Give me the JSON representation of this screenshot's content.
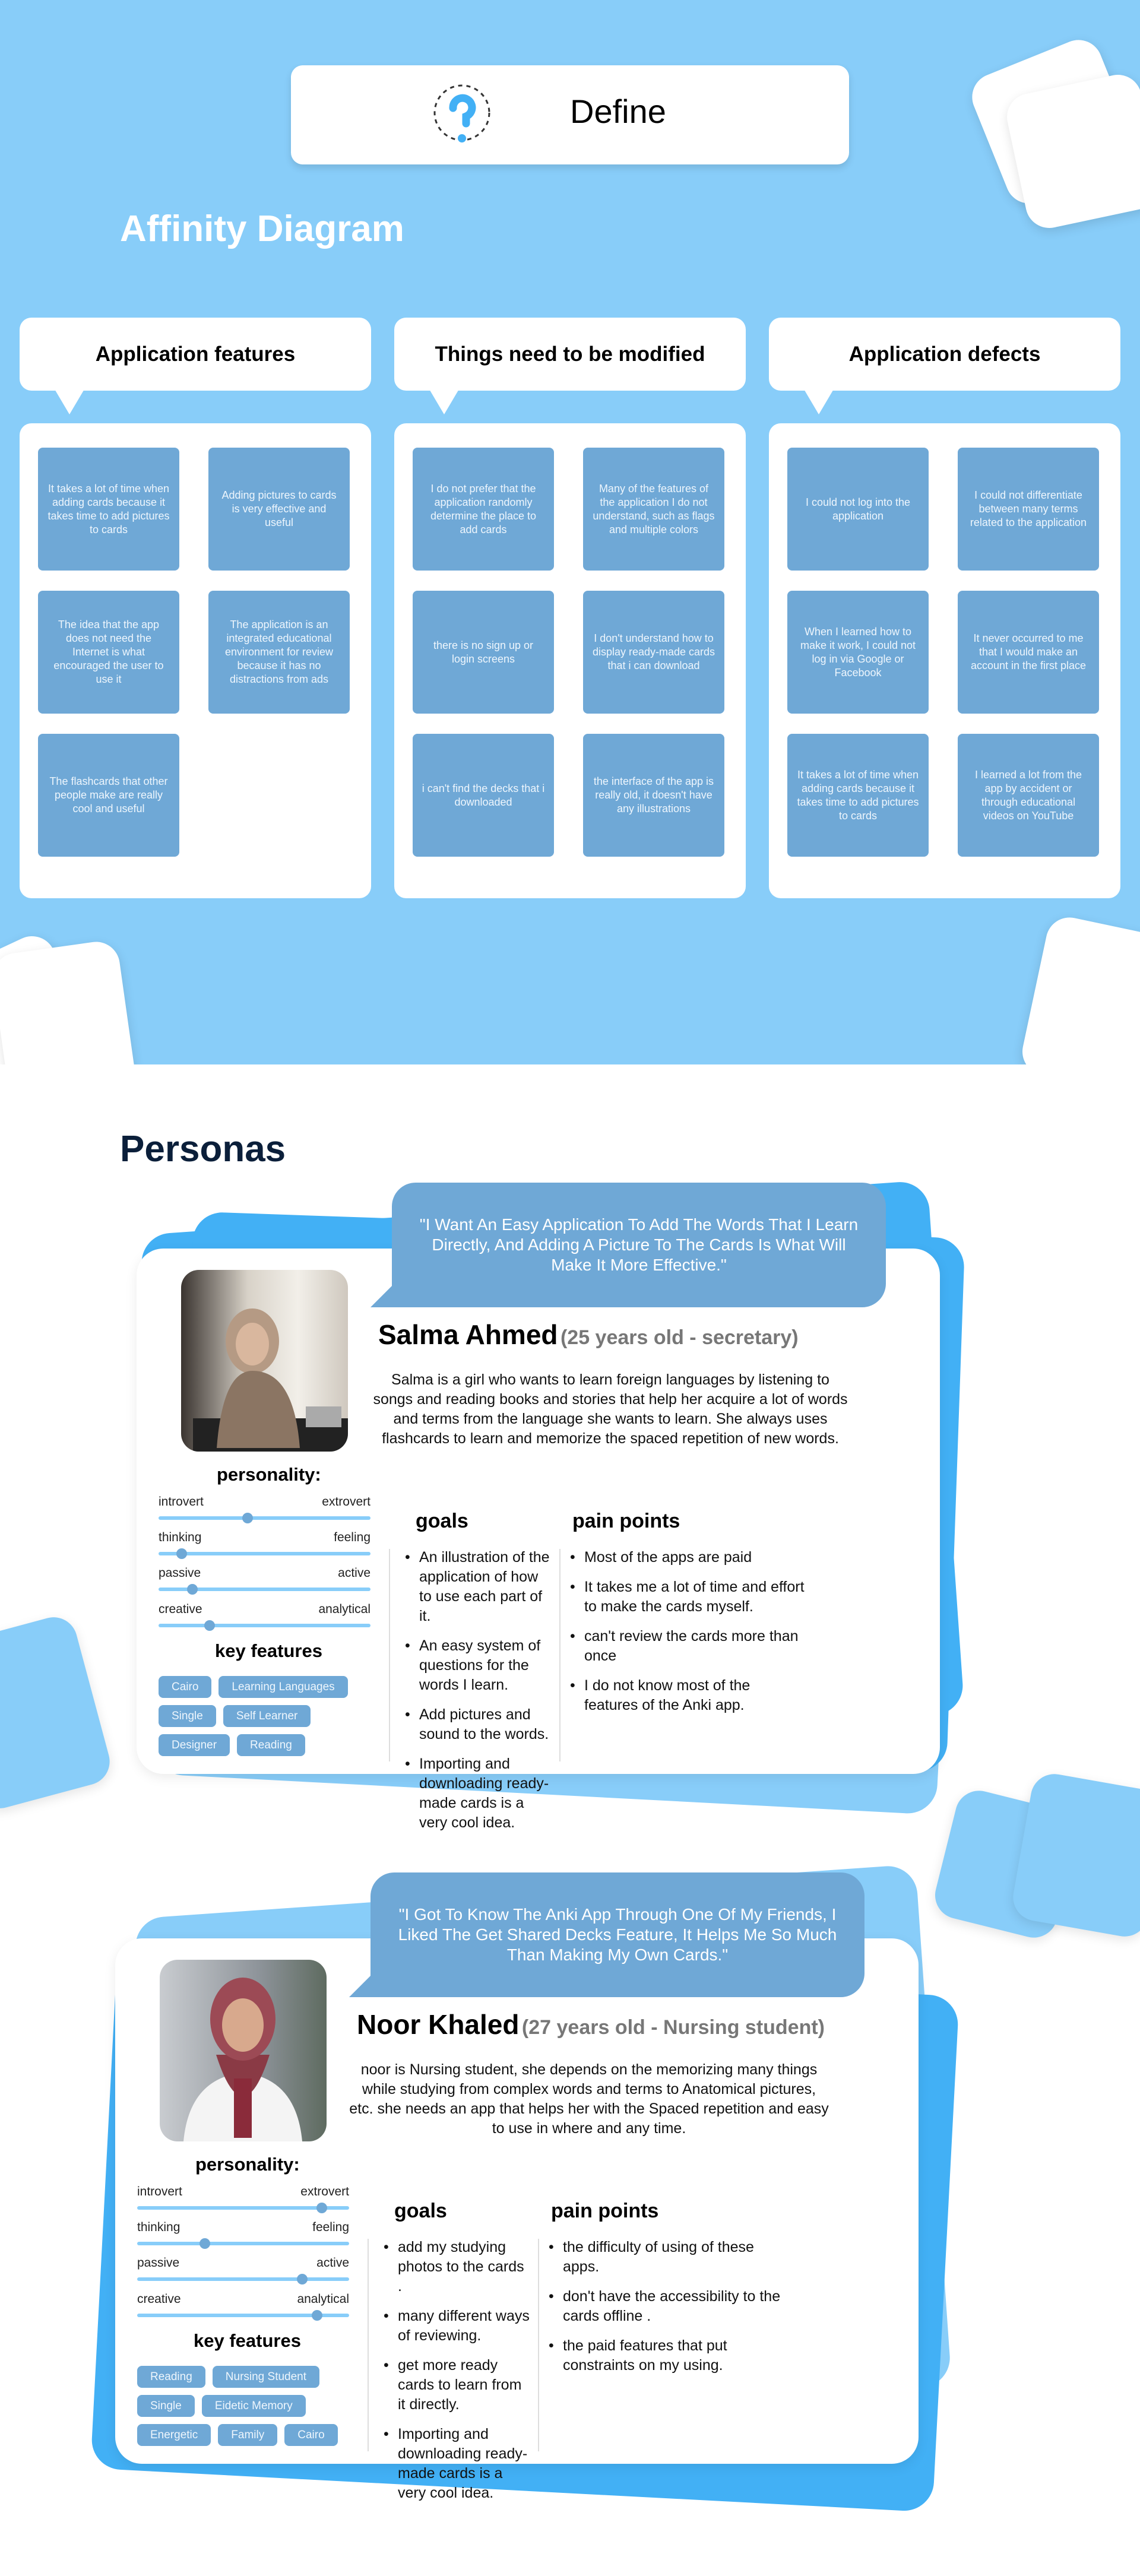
{
  "header": {
    "title": "Define",
    "icon": "question-mark-icon"
  },
  "affinity": {
    "title": "Affinity Diagram",
    "groups": [
      {
        "title": "Application features",
        "cards": [
          "It takes a lot of time when adding cards because it takes time to add pictures to cards",
          "Adding pictures to cards is very effective and useful",
          "The idea that the app does not need the Internet is what encouraged the user to use it",
          "The application is an integrated educational environment for review because it has no distractions from ads",
          "The flashcards that other people make are really cool and useful"
        ]
      },
      {
        "title": "Things need to be modified",
        "cards": [
          "I do not prefer that the application randomly determine the place to add cards",
          "Many of the features of the application I do not understand, such as flags and multiple colors",
          "there is no sign up or login screens",
          "I don't understand how to display ready-made cards that i can download",
          "i can't find the decks that i downloaded",
          "the interface of the app is really old, it doesn't have any illustrations"
        ]
      },
      {
        "title": "Application defects",
        "cards": [
          "I could not log into the application",
          "I could not differentiate between many terms related to the application",
          "When I learned how to make it work, I could not log in via Google or Facebook",
          "It never occurred to me that I would make an account in the first place",
          "It takes a lot of time when adding cards because it takes time to add pictures to cards",
          "I learned a lot from the app by accident or through educational videos on YouTube"
        ]
      }
    ]
  },
  "personas": {
    "title": "Personas",
    "personality_label": "personality:",
    "key_features_label": "key features",
    "goals_label": "goals",
    "pain_label": "pain points",
    "items": [
      {
        "quote": "\"I Want An Easy Application To Add The Words That I Learn Directly, And Adding A Picture To The Cards Is What Will Make It More Effective.\"",
        "name": "Salma Ahmed",
        "age": "(25 years old - secretary)",
        "description": "Salma is a girl who wants to learn foreign languages by listening to songs and reading books and stories that help her acquire a lot of words and terms from the language she wants to learn. She always uses flashcards to learn and memorize the spaced repetition of new words.",
        "sliders": [
          {
            "left": "introvert",
            "right": "extrovert",
            "value": 0.42
          },
          {
            "left": "thinking",
            "right": "feeling",
            "value": 0.11
          },
          {
            "left": "passive",
            "right": "active",
            "value": 0.16
          },
          {
            "left": "creative",
            "right": "analytical",
            "value": 0.24
          }
        ],
        "tags": [
          [
            "Cairo",
            "Learning Languages"
          ],
          [
            "Single",
            "Self Learner"
          ],
          [
            "Designer",
            "Reading"
          ]
        ],
        "goals": [
          "An illustration of the application of how to use each part of it.",
          "An easy system of questions for the words I learn.",
          "Add pictures and sound to the words.",
          "Importing and downloading ready-made cards is a very cool idea."
        ],
        "pains": [
          "Most of the apps are paid",
          "It takes me a lot of time and effort to make the cards myself.",
          "can't review the cards more than once",
          "I do not know most of the features of the Anki app."
        ]
      },
      {
        "quote": "\"I Got To Know The Anki App Through One Of My Friends, I Liked The Get Shared Decks Feature, It Helps Me So Much Than Making My Own Cards.\"",
        "name": "Noor Khaled",
        "age": "(27 years old - Nursing student)",
        "description": "noor is Nursing student, she depends on the memorizing many things while studying from complex words and terms to Anatomical pictures, etc. she needs an app that helps her with the Spaced repetition and easy to use in where and any time.",
        "sliders": [
          {
            "left": "introvert",
            "right": "extrovert",
            "value": 0.87
          },
          {
            "left": "thinking",
            "right": "feeling",
            "value": 0.32
          },
          {
            "left": "passive",
            "right": "active",
            "value": 0.78
          },
          {
            "left": "creative",
            "right": "analytical",
            "value": 0.85
          }
        ],
        "tags": [
          [
            "Reading",
            "Nursing Student"
          ],
          [
            "Single",
            "Eidetic Memory"
          ],
          [
            "Energetic",
            "Family",
            "Cairo"
          ]
        ],
        "goals": [
          "add my studying photos to the cards .",
          "many different ways of reviewing.",
          "get more ready cards to learn from it directly.",
          "Importing and downloading ready-made cards is a very cool idea."
        ],
        "pains": [
          "the difficulty of using of these apps.",
          " don't have the accessibility to the cards offline .",
          "the paid features that put constraints on my using."
        ]
      }
    ]
  },
  "colors": {
    "bg_light": "#88CDF9",
    "bg_dark": "#42B0F5",
    "card": "#6FA8D6",
    "title_dark": "#0B1F3A"
  }
}
